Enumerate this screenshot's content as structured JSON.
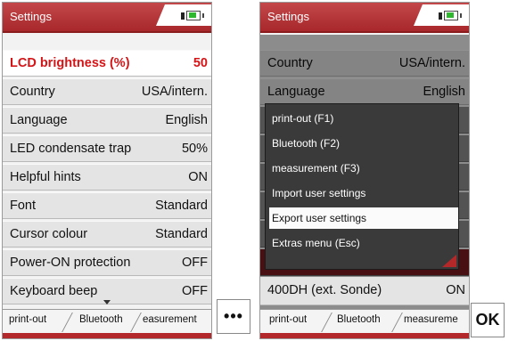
{
  "left_screen": {
    "title": "Settings",
    "rows": [
      {
        "label": "LCD brightness (%)",
        "value": "50",
        "selected": true
      },
      {
        "label": "Country",
        "value": "USA/intern."
      },
      {
        "label": "Language",
        "value": "English"
      },
      {
        "label": "LED condensate trap",
        "value": "50%"
      },
      {
        "label": "Helpful hints",
        "value": "ON"
      },
      {
        "label": "Font",
        "value": "Standard"
      },
      {
        "label": "Cursor colour",
        "value": "Standard"
      },
      {
        "label": "Power-ON protection",
        "value": "OFF"
      },
      {
        "label": "Keyboard beep",
        "value": "OFF"
      }
    ],
    "softkeys": [
      "print-out",
      "Bluetooth",
      "easurement"
    ]
  },
  "right_screen": {
    "title": "Settings",
    "top_rows": [
      {
        "label": "Country",
        "value": "USA/intern."
      },
      {
        "label": "Language",
        "value": "English"
      }
    ],
    "menu_items": [
      {
        "label": "print-out (F1)"
      },
      {
        "label": "Bluetooth (F2)"
      },
      {
        "label": "measurement (F3)"
      },
      {
        "label": "Import user settings"
      },
      {
        "label": "Export user settings",
        "highlighted": true
      },
      {
        "label": "Extras menu (Esc)"
      }
    ],
    "bottom_row": {
      "label": "400DH (ext. Sonde)",
      "value": "ON"
    },
    "softkeys": [
      "print-out",
      "Bluetooth",
      "measureme"
    ]
  },
  "buttons": {
    "more_label": "•••",
    "ok_label": "OK"
  },
  "colors": {
    "brand_red": "#b3282a",
    "selected_text": "#d41518",
    "battery_green": "#2fb82f"
  },
  "icons": [
    "battery-icon",
    "scroll-down-arrow-icon"
  ]
}
